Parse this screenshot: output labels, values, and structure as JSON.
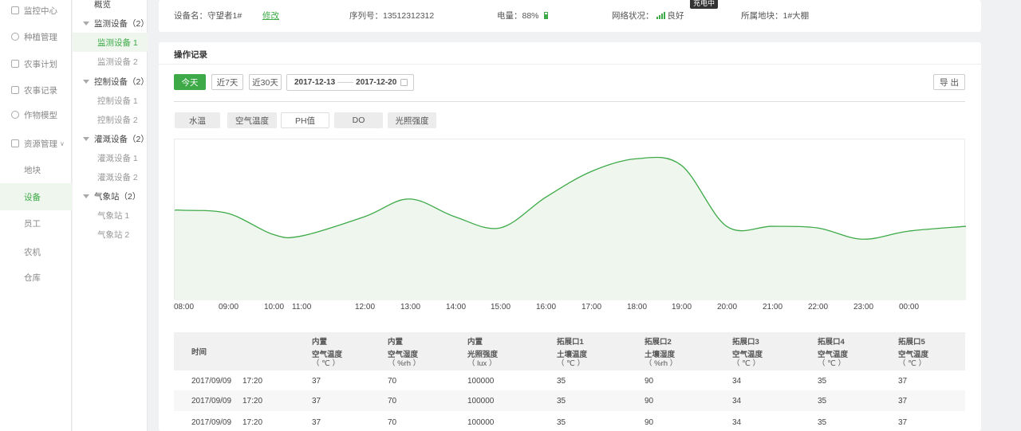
{
  "sidebar": {
    "items": [
      {
        "label": "监控中心",
        "icon": "monitor-icon"
      },
      {
        "label": "种植管理",
        "icon": "plant-icon"
      },
      {
        "label": "农事计划",
        "icon": "plan-icon"
      },
      {
        "label": "农事记录",
        "icon": "record-icon"
      },
      {
        "label": "作物模型",
        "icon": "model-icon"
      },
      {
        "label": "资源管理",
        "icon": "resource-icon"
      },
      {
        "label": "地块"
      },
      {
        "label": "设备"
      },
      {
        "label": "员工"
      },
      {
        "label": "农机"
      },
      {
        "label": "仓库"
      }
    ]
  },
  "tree": {
    "overview": "概览",
    "groups": [
      {
        "label": "监测设备（2）",
        "children": [
          "监测设备 1",
          "监测设备 2"
        ]
      },
      {
        "label": "控制设备（2）",
        "children": [
          "控制设备 1",
          "控制设备 2"
        ]
      },
      {
        "label": "灌溉设备（2）",
        "children": [
          "灌溉设备 1",
          "灌溉设备 2"
        ]
      },
      {
        "label": "气象站（2）",
        "children": [
          "气象站 1",
          "气象站 2"
        ]
      }
    ]
  },
  "device_info": {
    "name": "设备名：守望者1#",
    "edit": "修改",
    "serial": "序列号：13512312312",
    "battery": "电量：88%",
    "battery_level": 0.88,
    "charging_tip": "充电中",
    "network_label": "网络状况：",
    "network_value": "良好",
    "location": "所属地块：1#大棚"
  },
  "records": {
    "title": "操作记录",
    "btn_today": "今天",
    "btn_7days": "近7天",
    "btn_30days": "近30天",
    "date_start": "2017-12-13",
    "date_end": "2017-12-20",
    "export": "导 出",
    "tabs": [
      "水温",
      "空气温度",
      "PH值",
      "DO",
      "光照强度"
    ],
    "active_tab": "PH值"
  },
  "chart_data": {
    "type": "area",
    "x": [
      "08:00",
      "09:00",
      "10:00",
      "11:00",
      "12:00",
      "13:00",
      "14:00",
      "15:00",
      "16:00",
      "17:00",
      "18:00",
      "19:00",
      "20:00",
      "21:00",
      "22:00",
      "23:00",
      "00:00"
    ],
    "series": [
      {
        "values": [
          56,
          54,
          41,
          40,
          52,
          63,
          52,
          45,
          64,
          80,
          88,
          84,
          46,
          46,
          45,
          38,
          43
        ]
      }
    ],
    "ylim": [
      0,
      100
    ],
    "color": "#3daa47",
    "fill": "#eef6ee"
  },
  "table": {
    "col_time": "时间",
    "columns": [
      {
        "l1": "内置",
        "l2": "空气温度",
        "unit": "（ ℃ ）"
      },
      {
        "l1": "内置",
        "l2": "空气湿度",
        "unit": "（ %rh ）"
      },
      {
        "l1": "内置",
        "l2": "光照强度",
        "unit": "（ lux ）"
      },
      {
        "l1": "拓展口1",
        "l2": "土壤温度",
        "unit": "（ ℃ ）"
      },
      {
        "l1": "拓展口2",
        "l2": "土壤湿度",
        "unit": "（ %rh ）"
      },
      {
        "l1": "拓展口3",
        "l2": "空气温度",
        "unit": "（ ℃ ）"
      },
      {
        "l1": "拓展口4",
        "l2": "空气温度",
        "unit": "（ ℃ ）"
      },
      {
        "l1": "拓展口5",
        "l2": "空气温度",
        "unit": "（ ℃ ）"
      }
    ],
    "rows": [
      {
        "date": "2017/09/09",
        "time": "17:20",
        "cells": [
          "37",
          "70",
          "100000",
          "35",
          "90",
          "34",
          "35",
          "37"
        ]
      },
      {
        "date": "2017/09/09",
        "time": "17:20",
        "cells": [
          "37",
          "70",
          "100000",
          "35",
          "90",
          "34",
          "35",
          "37"
        ]
      },
      {
        "date": "2017/09/09",
        "time": "17:20",
        "cells": [
          "37",
          "70",
          "100000",
          "35",
          "90",
          "34",
          "35",
          "37"
        ]
      }
    ]
  }
}
